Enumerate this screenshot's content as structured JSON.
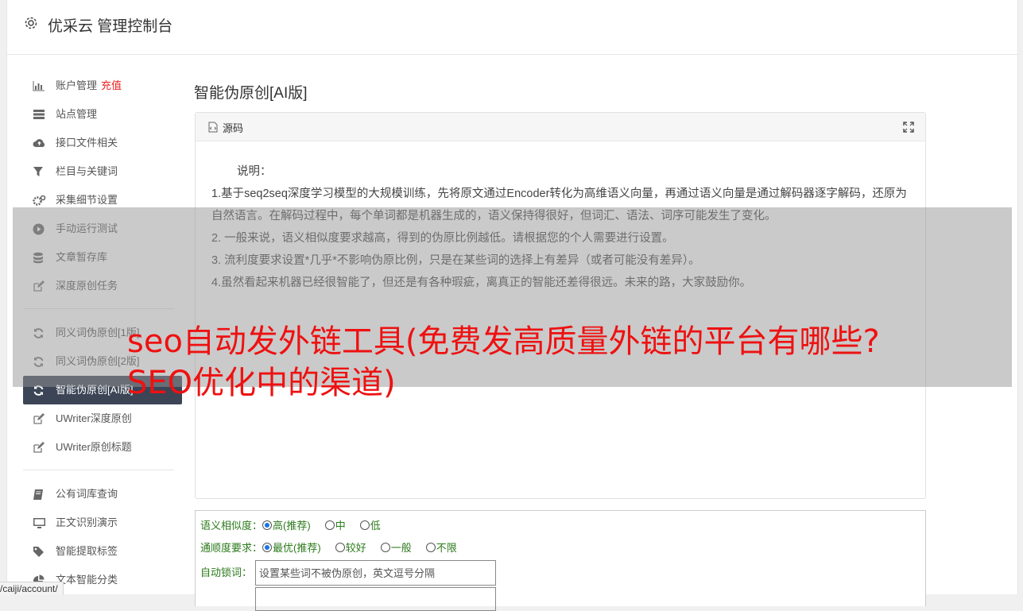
{
  "app": {
    "title": "优采云 管理控制台"
  },
  "sidebar": {
    "group1": [
      {
        "label": "账户管理",
        "badge": "充值",
        "icon": "bar-chart-icon"
      },
      {
        "label": "站点管理",
        "icon": "server-icon"
      },
      {
        "label": "接口文件相关",
        "icon": "cloud-upload-icon"
      },
      {
        "label": "栏目与关键词",
        "icon": "filter-icon"
      },
      {
        "label": "采集细节设置",
        "icon": "gears-icon"
      },
      {
        "label": "手动运行测试",
        "icon": "play-circle-icon"
      },
      {
        "label": "文章暂存库",
        "icon": "database-icon"
      },
      {
        "label": "深度原创任务",
        "icon": "edit-icon"
      }
    ],
    "group2": [
      {
        "label": "同义词伪原创[1版]",
        "icon": "refresh-icon"
      },
      {
        "label": "同义词伪原创[2版]",
        "icon": "refresh-icon"
      },
      {
        "label": "智能伪原创[AI版]",
        "icon": "refresh-icon",
        "active": true
      },
      {
        "label": "UWriter深度原创",
        "icon": "edit-icon"
      },
      {
        "label": "UWriter原创标题",
        "icon": "edit-icon"
      }
    ],
    "group3": [
      {
        "label": "公有词库查询",
        "icon": "book-icon"
      },
      {
        "label": "正文识别演示",
        "icon": "monitor-icon"
      },
      {
        "label": "智能提取标签",
        "icon": "tag-icon"
      },
      {
        "label": "文本智能分类",
        "icon": "pie-chart-icon"
      }
    ]
  },
  "main": {
    "page_title": "智能伪原创[AI版]",
    "panel_label": "源码",
    "intro": "说明：",
    "notes": [
      "1.基于seq2seq深度学习模型的大规模训练，先将原文通过Encoder转化为高维语义向量，再通过语义向量是通过解码器逐字解码，还原为自然语言。在解码过程中，每个单词都是机器生成的，语义保持得很好，但词汇、语法、词序可能发生了变化。",
      "2. 一般来说，语义相似度要求越高，得到的伪原比例越低。请根据您的个人需要进行设置。",
      "3. 流利度要求设置*几乎*不影响伪原比例，只是在某些词的选择上有差异（或者可能没有差异）。",
      "4.虽然看起来机器已经很智能了，但还是有各种瑕疵，离真正的智能还差得很远。未来的路，大家鼓励你。"
    ]
  },
  "options": {
    "similarity": {
      "label": "语义相似度：",
      "choices": [
        "高(推荐)",
        "中",
        "低"
      ],
      "selected": 0
    },
    "fluency": {
      "label": "通顺度要求：",
      "choices": [
        "最优(推荐)",
        "较好",
        "一般",
        "不限"
      ],
      "selected": 0
    },
    "lock": {
      "label": "自动锁词：",
      "placeholder": "设置某些词不被伪原创，英文逗号分隔"
    }
  },
  "overlay": {
    "headline": "seo自动发外链工具(免费发高质量外链的平台有哪些?SEO优化中的渠道)"
  },
  "status_bar": {
    "url": "/caiji/account/"
  },
  "colors": {
    "active_bg": "#3b4556",
    "headline": "#ee1111",
    "recharge": "#ee2222",
    "option_label": "#2c7a1c"
  }
}
